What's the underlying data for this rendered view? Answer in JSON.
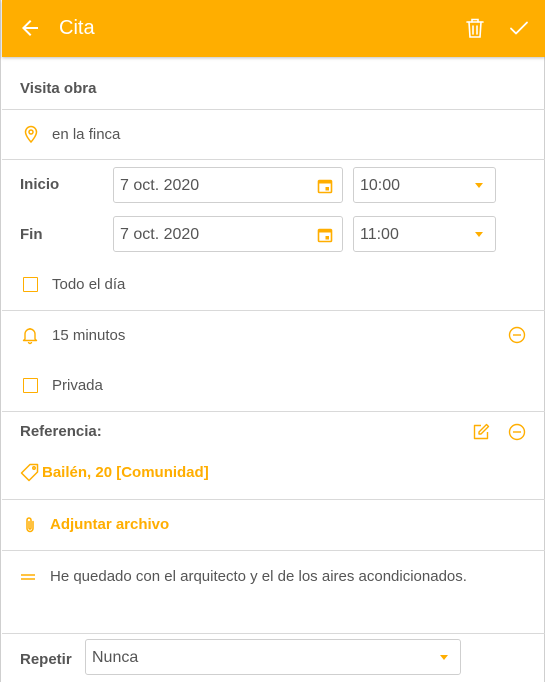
{
  "header": {
    "title": "Cita",
    "bg_color": "#ffae00"
  },
  "event": {
    "title": "Visita obra",
    "location": "en la finca"
  },
  "start": {
    "label": "Inicio",
    "date": "7 oct. 2020",
    "time": "10:00"
  },
  "end": {
    "label": "Fin",
    "date": "7 oct. 2020",
    "time": "11:00"
  },
  "all_day": {
    "label": "Todo el día",
    "checked": false
  },
  "reminder": {
    "label": "15 minutos"
  },
  "private": {
    "label": "Privada",
    "checked": false
  },
  "reference": {
    "label": "Referencia:",
    "tag": "Bailén, 20 [Comunidad]"
  },
  "attach": {
    "label": "Adjuntar archivo"
  },
  "notes": {
    "text": "He quedado con el arquitecto y el de los aires acondicionados."
  },
  "repeat": {
    "label": "Repetir",
    "value": "Nunca"
  },
  "accent_color": "#ffae00"
}
